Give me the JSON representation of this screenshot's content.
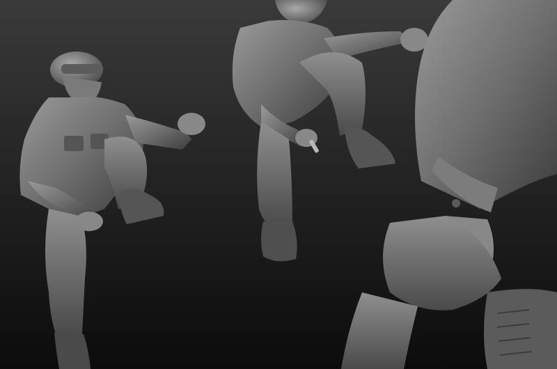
{
  "scene": {
    "kind": "3D sculpt render of a seated soldier figure in multiple views",
    "views": [
      "figure-view-left",
      "figure-view-top",
      "figure-view-closeup"
    ],
    "colors": {
      "background_top": "#3a3a3a",
      "background_bottom": "#0c0c0c",
      "clay": "#6e6e6e",
      "clay_light": "#9a9a9a",
      "clay_dark": "#3c3c3c",
      "cigarette": "#b8b8b8",
      "ember": "#9a2a2a"
    }
  }
}
